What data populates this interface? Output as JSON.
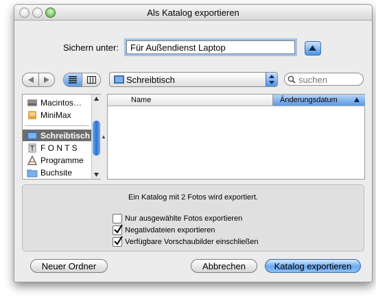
{
  "window": {
    "title": "Als Katalog exportieren"
  },
  "save": {
    "label": "Sichern unter:",
    "value": "Für Außendienst Laptop"
  },
  "location": {
    "selected": "Schreibtisch"
  },
  "search": {
    "placeholder": "suchen"
  },
  "sidebar": {
    "items": [
      {
        "label": "Macintos…",
        "icon": "hard-drive-icon"
      },
      {
        "label": "MiniMax",
        "icon": "disk-image-icon"
      },
      {
        "label": "Schreibtisch",
        "icon": "desktop-icon",
        "selected": true
      },
      {
        "label": "F O N T S",
        "icon": "fonts-folder-icon"
      },
      {
        "label": "Programme",
        "icon": "applications-icon"
      },
      {
        "label": "Buchsite",
        "icon": "folder-icon"
      }
    ]
  },
  "filelist": {
    "columns": [
      "Name",
      "Änderungsdatum"
    ],
    "sort_column": "Änderungsdatum",
    "sort_direction": "ascending"
  },
  "options": {
    "info": "Ein Katalog mit 2 Fotos wird exportiert.",
    "checkboxes": [
      {
        "label": "Nur ausgewählte Fotos exportieren",
        "checked": false
      },
      {
        "label": "Negativdateien exportieren",
        "checked": true
      },
      {
        "label": "Verfügbare Vorschaubilder einschließen",
        "checked": true
      }
    ]
  },
  "buttons": {
    "new_folder": "Neuer Ordner",
    "cancel": "Abbrechen",
    "export": "Katalog exportieren"
  },
  "colors": {
    "accent": "#5b9be6",
    "selection": "#6d6d6d"
  }
}
